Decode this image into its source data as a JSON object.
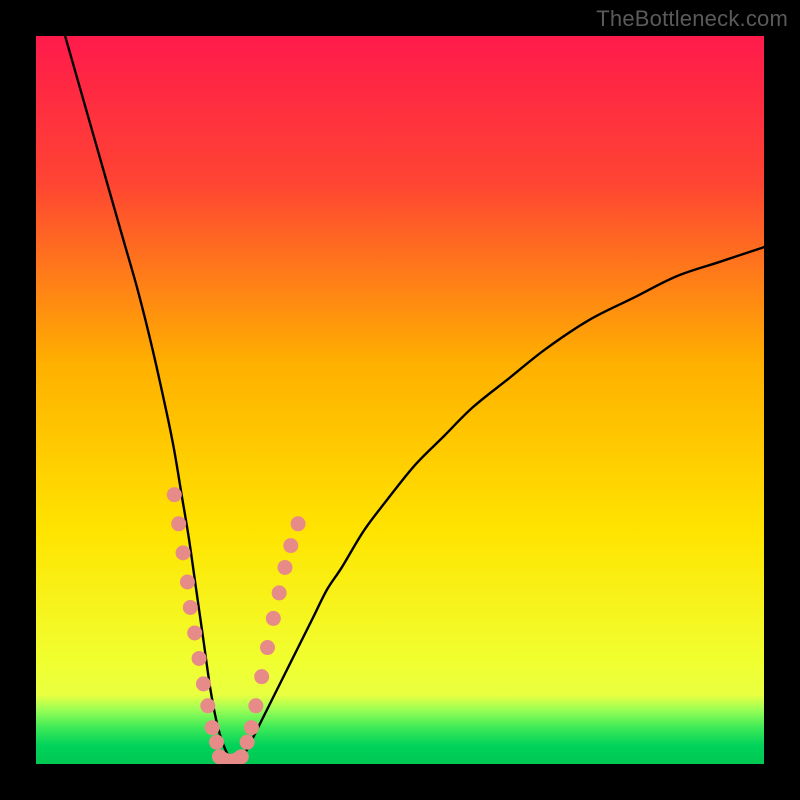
{
  "watermark": "TheBottleneck.com",
  "chart_data": {
    "type": "line",
    "title": "",
    "xlabel": "",
    "ylabel": "",
    "xlim": [
      0,
      100
    ],
    "ylim": [
      0,
      100
    ],
    "colors": {
      "gradient_top": "#ff1a4b",
      "gradient_upper_mid": "#ff7a2a",
      "gradient_mid": "#ffd400",
      "gradient_lower_mid": "#f7ff2a",
      "gradient_green_band": "#3eea57",
      "gradient_bottom": "#00c853",
      "curve": "#000000",
      "markers": "#e78b88"
    },
    "gradient_stops": [
      {
        "offset": 0.0,
        "color": "#ff1a4b"
      },
      {
        "offset": 0.2,
        "color": "#ff4433"
      },
      {
        "offset": 0.45,
        "color": "#ffb000"
      },
      {
        "offset": 0.68,
        "color": "#ffe400"
      },
      {
        "offset": 0.86,
        "color": "#f0ff30"
      },
      {
        "offset": 0.905,
        "color": "#e9ff40"
      },
      {
        "offset": 0.925,
        "color": "#9cff55"
      },
      {
        "offset": 0.95,
        "color": "#3eea57"
      },
      {
        "offset": 0.975,
        "color": "#00d25a"
      },
      {
        "offset": 1.0,
        "color": "#00c853"
      }
    ],
    "series": [
      {
        "name": "bottleneck-curve",
        "x": [
          4,
          6,
          8,
          10,
          12,
          14,
          16,
          18,
          19,
          20,
          21,
          22,
          23,
          24,
          25,
          26,
          27,
          28,
          29,
          30,
          32,
          34,
          36,
          38,
          40,
          42,
          45,
          48,
          52,
          56,
          60,
          65,
          70,
          76,
          82,
          88,
          94,
          100
        ],
        "y": [
          100,
          93,
          86,
          79,
          72,
          65,
          57,
          48,
          43,
          37,
          31,
          24,
          17,
          10,
          5,
          2,
          0.5,
          0.5,
          2,
          4,
          8,
          12,
          16,
          20,
          24,
          27,
          32,
          36,
          41,
          45,
          49,
          53,
          57,
          61,
          64,
          67,
          69,
          71
        ]
      }
    ],
    "markers": {
      "left_cluster": {
        "x": [
          19.0,
          19.6,
          20.2,
          20.8,
          21.2,
          21.8,
          22.4,
          23.0,
          23.6,
          24.2,
          24.8
        ],
        "y": [
          37.0,
          33.0,
          29.0,
          25.0,
          21.5,
          18.0,
          14.5,
          11.0,
          8.0,
          5.0,
          3.0
        ]
      },
      "right_cluster": {
        "x": [
          29.0,
          29.6,
          30.2,
          31.0,
          31.8,
          32.6,
          33.4,
          34.2,
          35.0,
          36.0
        ],
        "y": [
          3.0,
          5.0,
          8.0,
          12.0,
          16.0,
          20.0,
          23.5,
          27.0,
          30.0,
          33.0
        ]
      },
      "bottom_cluster": {
        "x": [
          25.2,
          25.8,
          26.4,
          27.0,
          27.6,
          28.2
        ],
        "y": [
          1.0,
          0.6,
          0.4,
          0.4,
          0.6,
          1.0
        ]
      }
    }
  }
}
